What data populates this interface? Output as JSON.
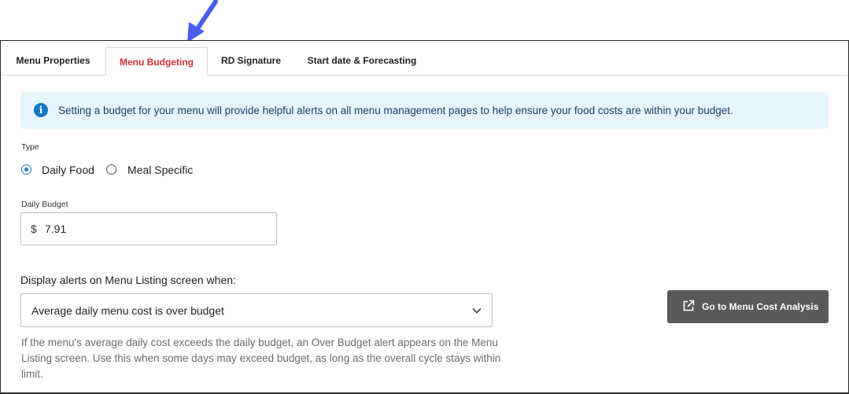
{
  "tabs": [
    {
      "label": "Menu Properties",
      "active": false
    },
    {
      "label": "Menu Budgeting",
      "active": true
    },
    {
      "label": "RD Signature",
      "active": false
    },
    {
      "label": "Start date & Forecasting",
      "active": false
    }
  ],
  "info_banner": {
    "icon": "info-icon",
    "text": "Setting a budget for your menu will provide helpful alerts on all menu management pages to help ensure your food costs are within your budget."
  },
  "type_section": {
    "label": "Type",
    "options": [
      {
        "label": "Daily Food",
        "selected": true
      },
      {
        "label": "Meal Specific",
        "selected": false
      }
    ]
  },
  "daily_budget": {
    "label": "Daily Budget",
    "prefix": "$",
    "value": "7.91"
  },
  "alerts": {
    "label": "Display alerts on Menu Listing screen when:",
    "selected": "Average daily menu cost is over budget",
    "help": "If the menu's average daily cost exceeds the daily budget, an Over Budget alert appears on the Menu Listing screen. Use this when some days may exceed budget, as long as the overall cycle stays within limit."
  },
  "cost_analysis_button": {
    "label": "Go to Menu Cost Analysis",
    "icon": "external-link-icon"
  },
  "colors": {
    "active_tab": "#d32f2f",
    "info_bg": "#e6f4fb",
    "radio_accent": "#1a7cc1",
    "button_bg": "#595959",
    "annotation_arrow": "#4a5cf0"
  }
}
